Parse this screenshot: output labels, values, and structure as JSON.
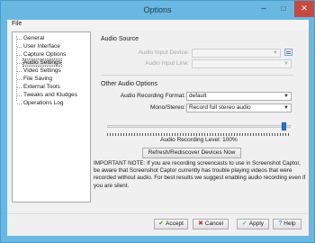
{
  "window": {
    "title": "Options"
  },
  "menu": {
    "file": "File"
  },
  "tree": {
    "items": [
      {
        "label": "General",
        "selected": false
      },
      {
        "label": "User Interface",
        "selected": false
      },
      {
        "label": "Capture Options",
        "selected": false
      },
      {
        "label": "Audio Settings",
        "selected": true
      },
      {
        "label": "Video Settings",
        "selected": false
      },
      {
        "label": "File Saving",
        "selected": false
      },
      {
        "label": "External Tools",
        "selected": false
      },
      {
        "label": "Tweaks and Kludges",
        "selected": false
      },
      {
        "label": "Operations Log",
        "selected": false
      }
    ]
  },
  "audio_source": {
    "heading": "Audio Source",
    "input_device_label": "Audio Input Device:",
    "input_device_value": "",
    "input_line_label": "Audio Input Line:",
    "input_line_value": ""
  },
  "other_audio": {
    "heading": "Other Audio Options",
    "format_label": "Audio Recording Format:",
    "format_value": "default",
    "mono_stereo_label": "Mono/Stereo:",
    "mono_stereo_value": "Record full stereo audio",
    "level_label": "Audio Recording Level: 100%",
    "level_fraction": 1.0
  },
  "refresh_button": "Refresh/Rediscover Devices Now",
  "note": "IMPORTANT NOTE: If you are recording screencasts to use in Screenshot Captor, be aware that Screenshot Captor currently has trouble playing videos that were recorded without audio. For best results we suggest enabling audio recording even if you are silent.",
  "buttons": {
    "accept": "Accept",
    "cancel": "Cancel",
    "apply": "Apply",
    "help": "Help"
  },
  "colors": {
    "title_bar": "#6ab7e1",
    "close_button": "#c84a3f",
    "slider_thumb": "#1e7bd8",
    "accept_icon": "#2e9e2e",
    "cancel_icon": "#c83030"
  }
}
